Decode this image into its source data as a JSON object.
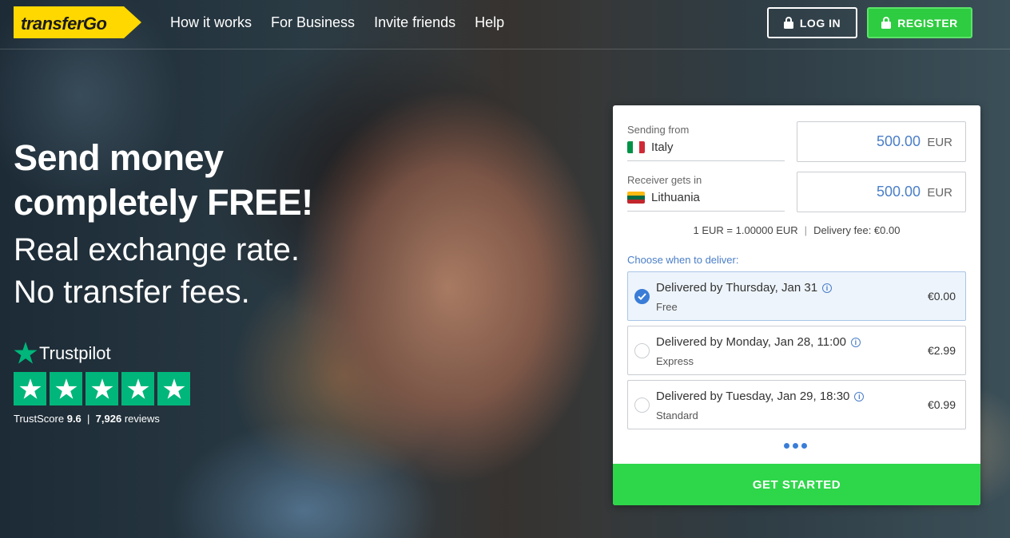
{
  "header": {
    "logo_text": "transferGo",
    "nav": [
      "How it works",
      "For Business",
      "Invite friends",
      "Help"
    ],
    "login_label": "LOG IN",
    "register_label": "REGISTER"
  },
  "hero": {
    "headline_1": "Send money",
    "headline_2": "completely FREE!",
    "subline_1": "Real exchange rate.",
    "subline_2": "No transfer fees."
  },
  "trustpilot": {
    "brand": "Trustpilot",
    "stars": 5,
    "score_label": "TrustScore",
    "score": "9.6",
    "reviews": "7,926",
    "reviews_label": "reviews"
  },
  "calculator": {
    "sending_label": "Sending from",
    "sending_country": "Italy",
    "sending_amount": "500.00",
    "sending_currency": "EUR",
    "receiver_label": "Receiver gets in",
    "receiver_country": "Lithuania",
    "receiver_amount": "500.00",
    "receiver_currency": "EUR",
    "rate": "1 EUR = 1.00000 EUR",
    "fee": "Delivery fee: €0.00",
    "deliver_title": "Choose when to deliver:",
    "options": [
      {
        "title": "Delivered by Thursday, Jan 31",
        "sub": "Free",
        "price": "€0.00",
        "selected": true
      },
      {
        "title": "Delivered by Monday, Jan 28, 11:00",
        "sub": "Express",
        "price": "€2.99",
        "selected": false
      },
      {
        "title": "Delivered by Tuesday, Jan 29, 18:30",
        "sub": "Standard",
        "price": "€0.99",
        "selected": false
      }
    ],
    "cta": "GET STARTED"
  },
  "colors": {
    "brand_yellow": "#ffd800",
    "accent_green": "#2ed74a",
    "link_blue": "#4a7ec7",
    "trustpilot_green": "#00b67a"
  }
}
